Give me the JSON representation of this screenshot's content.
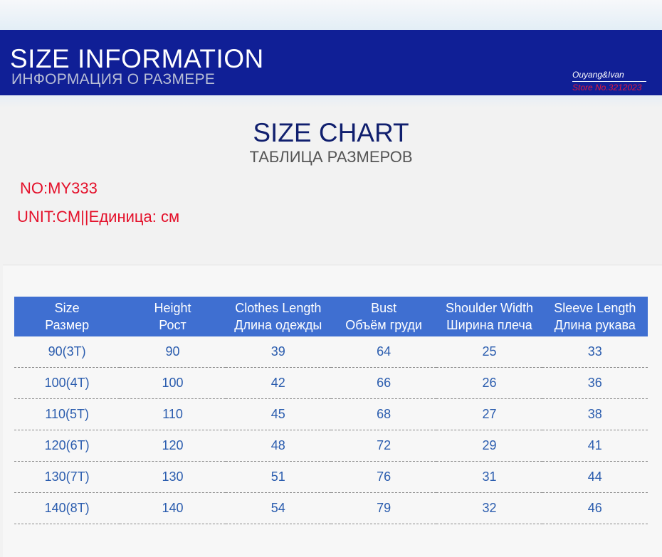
{
  "banner": {
    "title": "SIZE INFORMATION",
    "subtitle": "ИНФОРМАЦИЯ О РАЗМЕРЕ",
    "brand_name": "Ouyang&Ivan",
    "store": "Store No.3212023"
  },
  "chart": {
    "title": "SIZE CHART",
    "subtitle": "ТАБЛИЦА РАЗМЕРОВ",
    "model_no": "NO:MY333",
    "unit": "UNIT:CM||Единица: см"
  },
  "colors": {
    "banner_bg": "#101f96",
    "header_bg": "#3f6fd1",
    "accent_red": "#e4102a",
    "cell_text": "#2a5cae"
  },
  "table": {
    "headers": [
      {
        "en": "Size",
        "ru": "Размер"
      },
      {
        "en": "Height",
        "ru": "Рост"
      },
      {
        "en": "Clothes Length",
        "ru": "Длина одежды"
      },
      {
        "en": "Bust",
        "ru": "Объём груди"
      },
      {
        "en": "Shoulder Width",
        "ru": "Ширина плеча"
      },
      {
        "en": "Sleeve Length",
        "ru": "Длина рукава"
      }
    ],
    "rows": [
      [
        "90(3T)",
        "90",
        "39",
        "64",
        "25",
        "33"
      ],
      [
        "100(4T)",
        "100",
        "42",
        "66",
        "26",
        "36"
      ],
      [
        "110(5T)",
        "110",
        "45",
        "68",
        "27",
        "38"
      ],
      [
        "120(6T)",
        "120",
        "48",
        "72",
        "29",
        "41"
      ],
      [
        "130(7T)",
        "130",
        "51",
        "76",
        "31",
        "44"
      ],
      [
        "140(8T)",
        "140",
        "54",
        "79",
        "32",
        "46"
      ]
    ]
  }
}
